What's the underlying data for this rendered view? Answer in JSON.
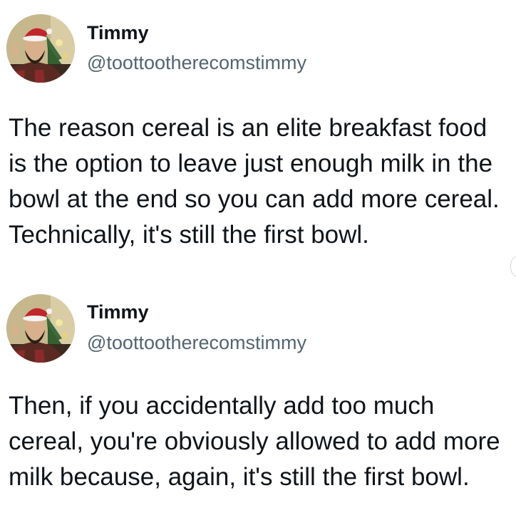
{
  "tweets": [
    {
      "author": {
        "name": "Timmy",
        "handle": "@toottootherecomstimmy"
      },
      "text": "The reason cereal is an elite breakfast food is the option to leave just enough milk in the bowl at the end so you can add more cereal. Technically, it's still the first bowl."
    },
    {
      "author": {
        "name": "Timmy",
        "handle": "@toottootherecomstimmy"
      },
      "text": "Then, if you accidentally add too much cereal, you're obviously allowed to add more milk because, again, it's still the first bowl."
    }
  ],
  "colors": {
    "text": "#0f1419",
    "handle": "#536471",
    "background": "#ffffff"
  }
}
